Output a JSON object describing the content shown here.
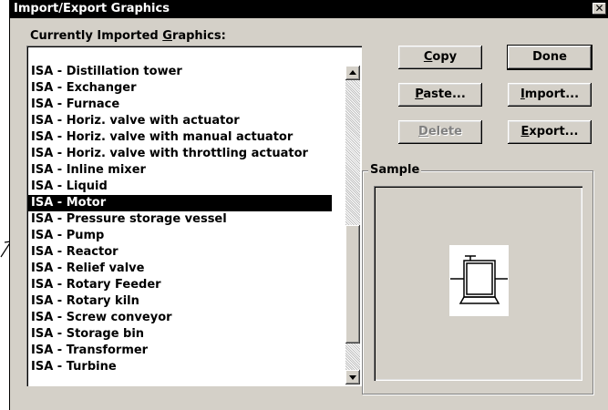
{
  "dialog": {
    "title": "Import/Export Graphics",
    "close_label": "✕"
  },
  "list": {
    "label_prefix": "Currently Imported ",
    "label_underlined": "G",
    "label_suffix": "raphics:",
    "items": [
      "ISA - Distillation tower",
      "ISA - Exchanger",
      "ISA - Furnace",
      "ISA - Horiz. valve with actuator",
      "ISA - Horiz. valve with manual actuator",
      "ISA - Horiz. valve with throttling actuator",
      "ISA - Inline mixer",
      "ISA - Liquid",
      "ISA - Motor",
      "ISA - Pressure storage vessel",
      "ISA - Pump",
      "ISA - Reactor",
      "ISA - Relief valve",
      "ISA - Rotary Feeder",
      "ISA - Rotary kiln",
      "ISA - Screw conveyor",
      "ISA - Storage bin",
      "ISA - Transformer",
      "ISA - Turbine"
    ],
    "selected_item": "ISA - Motor"
  },
  "buttons": {
    "copy": {
      "key": "C",
      "rest": "opy"
    },
    "done": {
      "label": "Done"
    },
    "paste": {
      "key": "P",
      "rest": "aste..."
    },
    "import": {
      "key": "I",
      "rest": "mport..."
    },
    "delete": {
      "key": "D",
      "rest": "elete"
    },
    "export": {
      "key": "E",
      "rest": "xport..."
    }
  },
  "sample": {
    "legend": "Sample",
    "icon": "motor-symbol-icon"
  },
  "colors": {
    "titlebar": "#000000",
    "dialog_face": "#d4d0c8",
    "selection": "#000000"
  }
}
